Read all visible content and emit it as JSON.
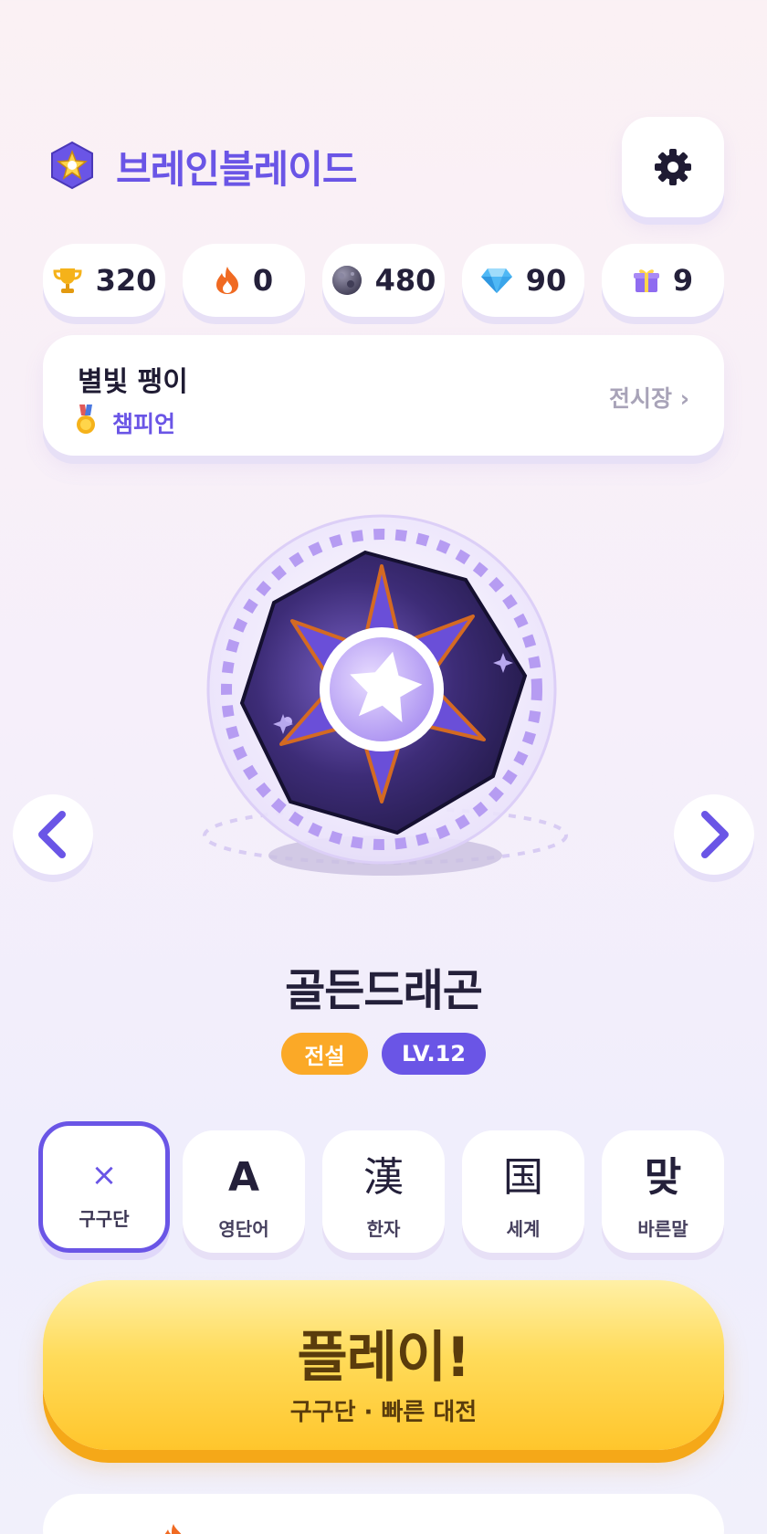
{
  "app": {
    "title": "브레인블레이드"
  },
  "icons": {
    "logo": "star-hexagon-icon",
    "settings": "gear-icon",
    "trophy": "trophy-icon",
    "streak": "flame-icon",
    "moon": "moon-icon",
    "gem": "diamond-icon",
    "gift": "gift-icon",
    "medal": "medal-icon",
    "prev": "chevron-left-icon",
    "next": "chevron-right-icon"
  },
  "stats": [
    {
      "icon": "trophy-icon",
      "value": "320"
    },
    {
      "icon": "flame-icon",
      "value": "0"
    },
    {
      "icon": "moon-icon",
      "value": "480"
    },
    {
      "icon": "diamond-icon",
      "value": "90"
    },
    {
      "icon": "gift-icon",
      "value": "9"
    }
  ],
  "profile": {
    "name": "별빛 팽이",
    "rank": "챔피언",
    "showcase_link": "전시장 ›"
  },
  "monster": {
    "name": "골든드래곤",
    "rarity": "전설",
    "level": "LV.12"
  },
  "modes": [
    {
      "glyph": "×",
      "label": "구구단",
      "selected": true
    },
    {
      "glyph": "A",
      "label": "영단어",
      "selected": false
    },
    {
      "glyph": "漢",
      "label": "한자",
      "selected": false
    },
    {
      "glyph": "国",
      "label": "세계",
      "selected": false
    },
    {
      "glyph": "맞",
      "label": "바른말",
      "selected": false
    }
  ],
  "play": {
    "title": "플레이!",
    "subtitle": "구구단 · 빠른 대전"
  },
  "colors": {
    "accent": "#6a55e6",
    "gold": "#fba927",
    "play": "#ffd54a",
    "text_dark": "#24203a"
  }
}
